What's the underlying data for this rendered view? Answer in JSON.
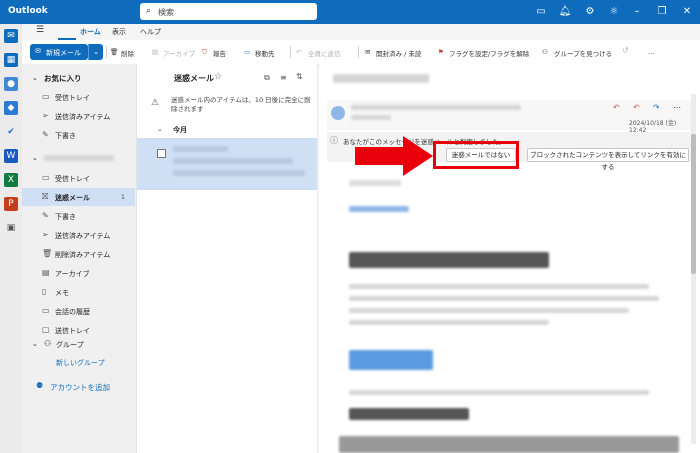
{
  "app": {
    "title": "Outlook"
  },
  "search": {
    "placeholder": "検索"
  },
  "ribbon": {
    "menu_icon": "hamburger-icon",
    "tabs": [
      {
        "label": "ホーム",
        "active": true
      },
      {
        "label": "表示",
        "active": false
      },
      {
        "label": "ヘルプ",
        "active": false
      }
    ]
  },
  "toolbar": {
    "new_mail": "新規メール",
    "delete": "削除",
    "archive": "アーカイブ",
    "report": "報告",
    "move": "移動先",
    "reply_all": "全員に返信",
    "read_unread": "開封済み / 未読",
    "flag": "フラグを設定/フラグを解除",
    "find_group": "グループを見つける",
    "more": "…"
  },
  "nav": {
    "favorites_header": "お気に入り",
    "favorites": [
      {
        "label": "受信トレイ",
        "icon": "inbox-icon"
      },
      {
        "label": "送信済みアイテム",
        "icon": "send-icon"
      },
      {
        "label": "下書き",
        "icon": "pencil-icon"
      }
    ],
    "folders": [
      {
        "label": "受信トレイ",
        "icon": "inbox-icon",
        "selected": false,
        "count": ""
      },
      {
        "label": "迷惑メール",
        "icon": "junk-icon",
        "selected": true,
        "count": "1"
      },
      {
        "label": "下書き",
        "icon": "pencil-icon",
        "selected": false,
        "count": ""
      },
      {
        "label": "送信済みアイテム",
        "icon": "send-icon",
        "selected": false,
        "count": ""
      },
      {
        "label": "削除済みアイテム",
        "icon": "trash-icon",
        "selected": false,
        "count": ""
      },
      {
        "label": "アーカイブ",
        "icon": "archive-icon",
        "selected": false,
        "count": ""
      },
      {
        "label": "メモ",
        "icon": "note-icon",
        "selected": false,
        "count": ""
      },
      {
        "label": "会話の履歴",
        "icon": "folder-icon",
        "selected": false,
        "count": ""
      },
      {
        "label": "送信トレイ",
        "icon": "outbox-icon",
        "selected": false,
        "count": ""
      }
    ],
    "groups_header": "グループ",
    "new_group": "新しいグループ",
    "add_account": "アカウントを追加"
  },
  "maillist": {
    "title": "迷惑メール",
    "notice": "迷惑メール内のアイテムは、10 日後に完全に削除されます",
    "section": "今月"
  },
  "reading": {
    "date": "2024/10/18 (金) 12:42",
    "info_text": "あなたがこのメッセージを迷惑メールと判定しました。",
    "not_junk_button": "迷惑メールではない",
    "show_blocked_button": "ブロックされたコンテンツを表示してリンクを有効にする"
  },
  "colors": {
    "accent": "#0f6cbd",
    "highlight": "#e8000b",
    "selected": "#cfe0f5"
  }
}
